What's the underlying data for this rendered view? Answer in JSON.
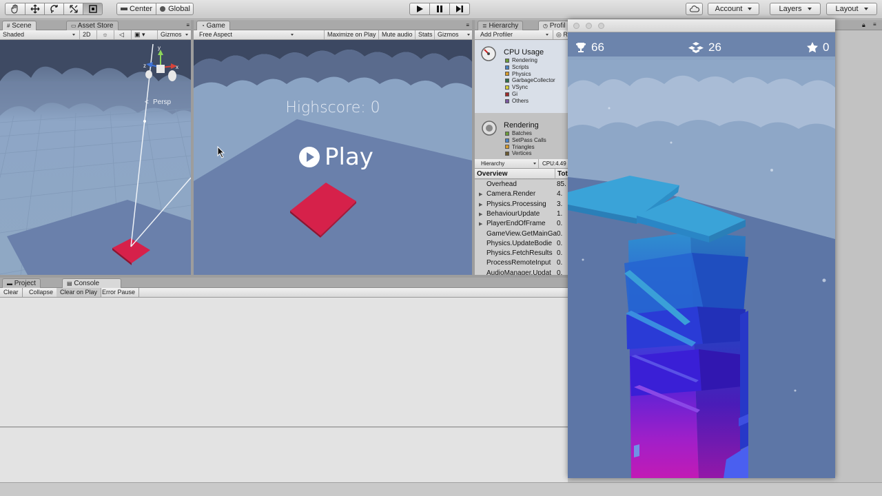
{
  "toolbar": {
    "pivot_label": "Center",
    "rotation_label": "Global",
    "account_label": "Account",
    "layers_label": "Layers",
    "layout_label": "Layout"
  },
  "scene": {
    "tab_label": "Scene",
    "asset_store_tab": "Asset Store",
    "shading_mode": "Shaded",
    "mode_2d": "2D",
    "gizmos_label": "Gizmos",
    "persp_label": "Persp",
    "axis_y": "y",
    "axis_x": "x",
    "axis_z": "z"
  },
  "game": {
    "tab_label": "Game",
    "aspect": "Free Aspect",
    "maximize_label": "Maximize on Play",
    "mute_label": "Mute audio",
    "stats_label": "Stats",
    "gizmos_label": "Gizmos",
    "highscore_text": "Highscore: 0",
    "play_text": "Play"
  },
  "hierarchy": {
    "tab_label": "Hierarchy"
  },
  "profiler": {
    "tab_label": "Profil",
    "add_profiler": "Add Profiler",
    "record_label": "R",
    "cpu_title": "CPU Usage",
    "cpu_legend": [
      {
        "label": "Rendering",
        "color": "#6b9b3a"
      },
      {
        "label": "Scripts",
        "color": "#4a82c4"
      },
      {
        "label": "Physics",
        "color": "#d69a2c"
      },
      {
        "label": "GarbageCollector",
        "color": "#2f6f4e"
      },
      {
        "label": "VSync",
        "color": "#d6cc3a"
      },
      {
        "label": "Gi",
        "color": "#a02c2c"
      },
      {
        "label": "Others",
        "color": "#7a5aa0"
      }
    ],
    "rendering_title": "Rendering",
    "rendering_legend": [
      {
        "label": "Batches",
        "color": "#6b9b3a"
      },
      {
        "label": "SetPass Calls",
        "color": "#4a82c4"
      },
      {
        "label": "Triangles",
        "color": "#d69a2c"
      },
      {
        "label": "Vertices",
        "color": "#6a5a30"
      }
    ],
    "view_mode": "Hierarchy",
    "cpu_readout": "CPU:4.49",
    "col_overview": "Overview",
    "col_total": "Tot",
    "rows": [
      {
        "name": "Overhead",
        "value": "85.",
        "expandable": false
      },
      {
        "name": "Camera.Render",
        "value": "4.",
        "expandable": true
      },
      {
        "name": "Physics.Processing",
        "value": "3.",
        "expandable": true
      },
      {
        "name": "BehaviourUpdate",
        "value": "1.",
        "expandable": true
      },
      {
        "name": "PlayerEndOfFrame",
        "value": "0.",
        "expandable": true
      },
      {
        "name": "GameView.GetMainGa",
        "value": "0.",
        "expandable": false
      },
      {
        "name": "Physics.UpdateBodie",
        "value": "0.",
        "expandable": false
      },
      {
        "name": "Physics.FetchResults",
        "value": "0.",
        "expandable": false
      },
      {
        "name": "ProcessRemoteInput",
        "value": "0.",
        "expandable": false
      },
      {
        "name": "AudioManager.Updat",
        "value": "0.",
        "expandable": false
      }
    ]
  },
  "bottom": {
    "project_tab": "Project",
    "console_tab": "Console",
    "clear_label": "Clear",
    "collapse_label": "Collapse",
    "clear_on_play_label": "Clear on Play",
    "error_pause_label": "Error Pause"
  },
  "player": {
    "trophy_count": "66",
    "blocks_count": "26",
    "star_count": "0"
  },
  "colors": {
    "sky": "#8fa7c7",
    "ground": "#5e78a6",
    "tile_red": "#d6214a",
    "block_top": "#2f97c9"
  }
}
